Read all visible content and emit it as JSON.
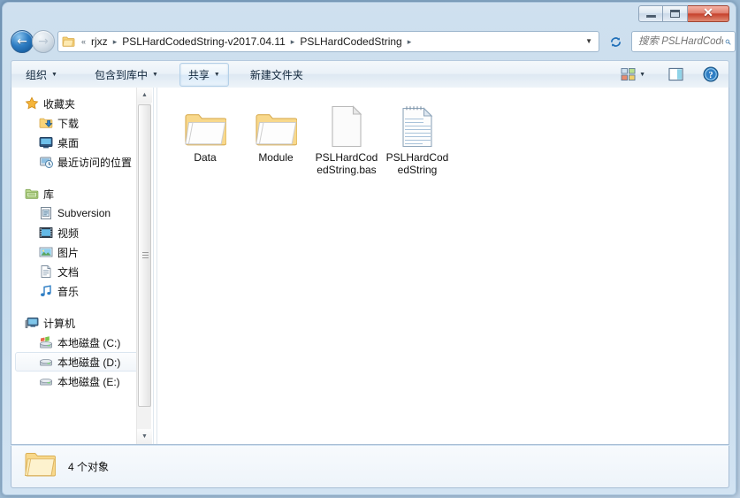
{
  "window": {
    "caption_buttons": [
      {
        "name": "minimize",
        "label": ""
      },
      {
        "name": "maximize",
        "label": ""
      },
      {
        "name": "close",
        "label": "✕"
      }
    ]
  },
  "address": {
    "back_glyph": "←",
    "forward_glyph": "→",
    "recent_caret": "▼",
    "folder_icon": "folder-icon",
    "prefix": "«",
    "crumbs": [
      "rjxz",
      "PSLHardCodedString-v2017.04.11",
      "PSLHardCodedString"
    ],
    "separator": "▸",
    "dropdown_caret": "▼",
    "refresh_glyph": "↻"
  },
  "search": {
    "placeholder": "搜索 PSLHardCodedString",
    "value": "",
    "icon": "search-icon"
  },
  "toolbar": {
    "organize_label": "组织",
    "include_library_label": "包含到库中",
    "share_label": "共享",
    "new_folder_label": "新建文件夹",
    "caret": "▼",
    "view_icon": "view-options-icon",
    "view_caret": "▼",
    "preview_icon": "preview-pane-icon",
    "help_icon": "help-icon",
    "help_glyph": "?"
  },
  "navpane": {
    "groups": [
      {
        "header": {
          "label": "收藏夹",
          "icon": "star-icon"
        },
        "items": [
          {
            "label": "下载",
            "icon": "downloads-folder-icon"
          },
          {
            "label": "桌面",
            "icon": "desktop-icon"
          },
          {
            "label": "最近访问的位置",
            "icon": "recent-places-icon"
          }
        ]
      },
      {
        "header": {
          "label": "库",
          "icon": "libraries-icon"
        },
        "items": [
          {
            "label": "Subversion",
            "icon": "subversion-icon"
          },
          {
            "label": "视频",
            "icon": "video-icon"
          },
          {
            "label": "图片",
            "icon": "pictures-icon"
          },
          {
            "label": "文档",
            "icon": "documents-icon"
          },
          {
            "label": "音乐",
            "icon": "music-icon"
          }
        ]
      },
      {
        "header": {
          "label": "计算机",
          "icon": "computer-icon"
        },
        "items": [
          {
            "label": "本地磁盘 (C:)",
            "icon": "system-drive-icon",
            "selected": false
          },
          {
            "label": "本地磁盘 (D:)",
            "icon": "drive-icon",
            "selected": true
          },
          {
            "label": "本地磁盘 (E:)",
            "icon": "drive-icon",
            "selected": false
          }
        ]
      }
    ],
    "scroll_up_glyph": "▲",
    "scroll_down_glyph": "▼"
  },
  "files": [
    {
      "name": "Data",
      "type": "folder"
    },
    {
      "name": "Module",
      "type": "folder"
    },
    {
      "name": "PSLHardCodedString.bas",
      "type": "blank-document"
    },
    {
      "name": "PSLHardCodedString",
      "type": "text-document"
    }
  ],
  "status": {
    "icon": "folder-icon",
    "text": "4 个对象"
  },
  "colors": {
    "accent_blue": "#2f7ec4",
    "close_red": "#c6412c",
    "folder_yellow": "#fbdd8a",
    "window_chrome": "#c5dbec"
  }
}
